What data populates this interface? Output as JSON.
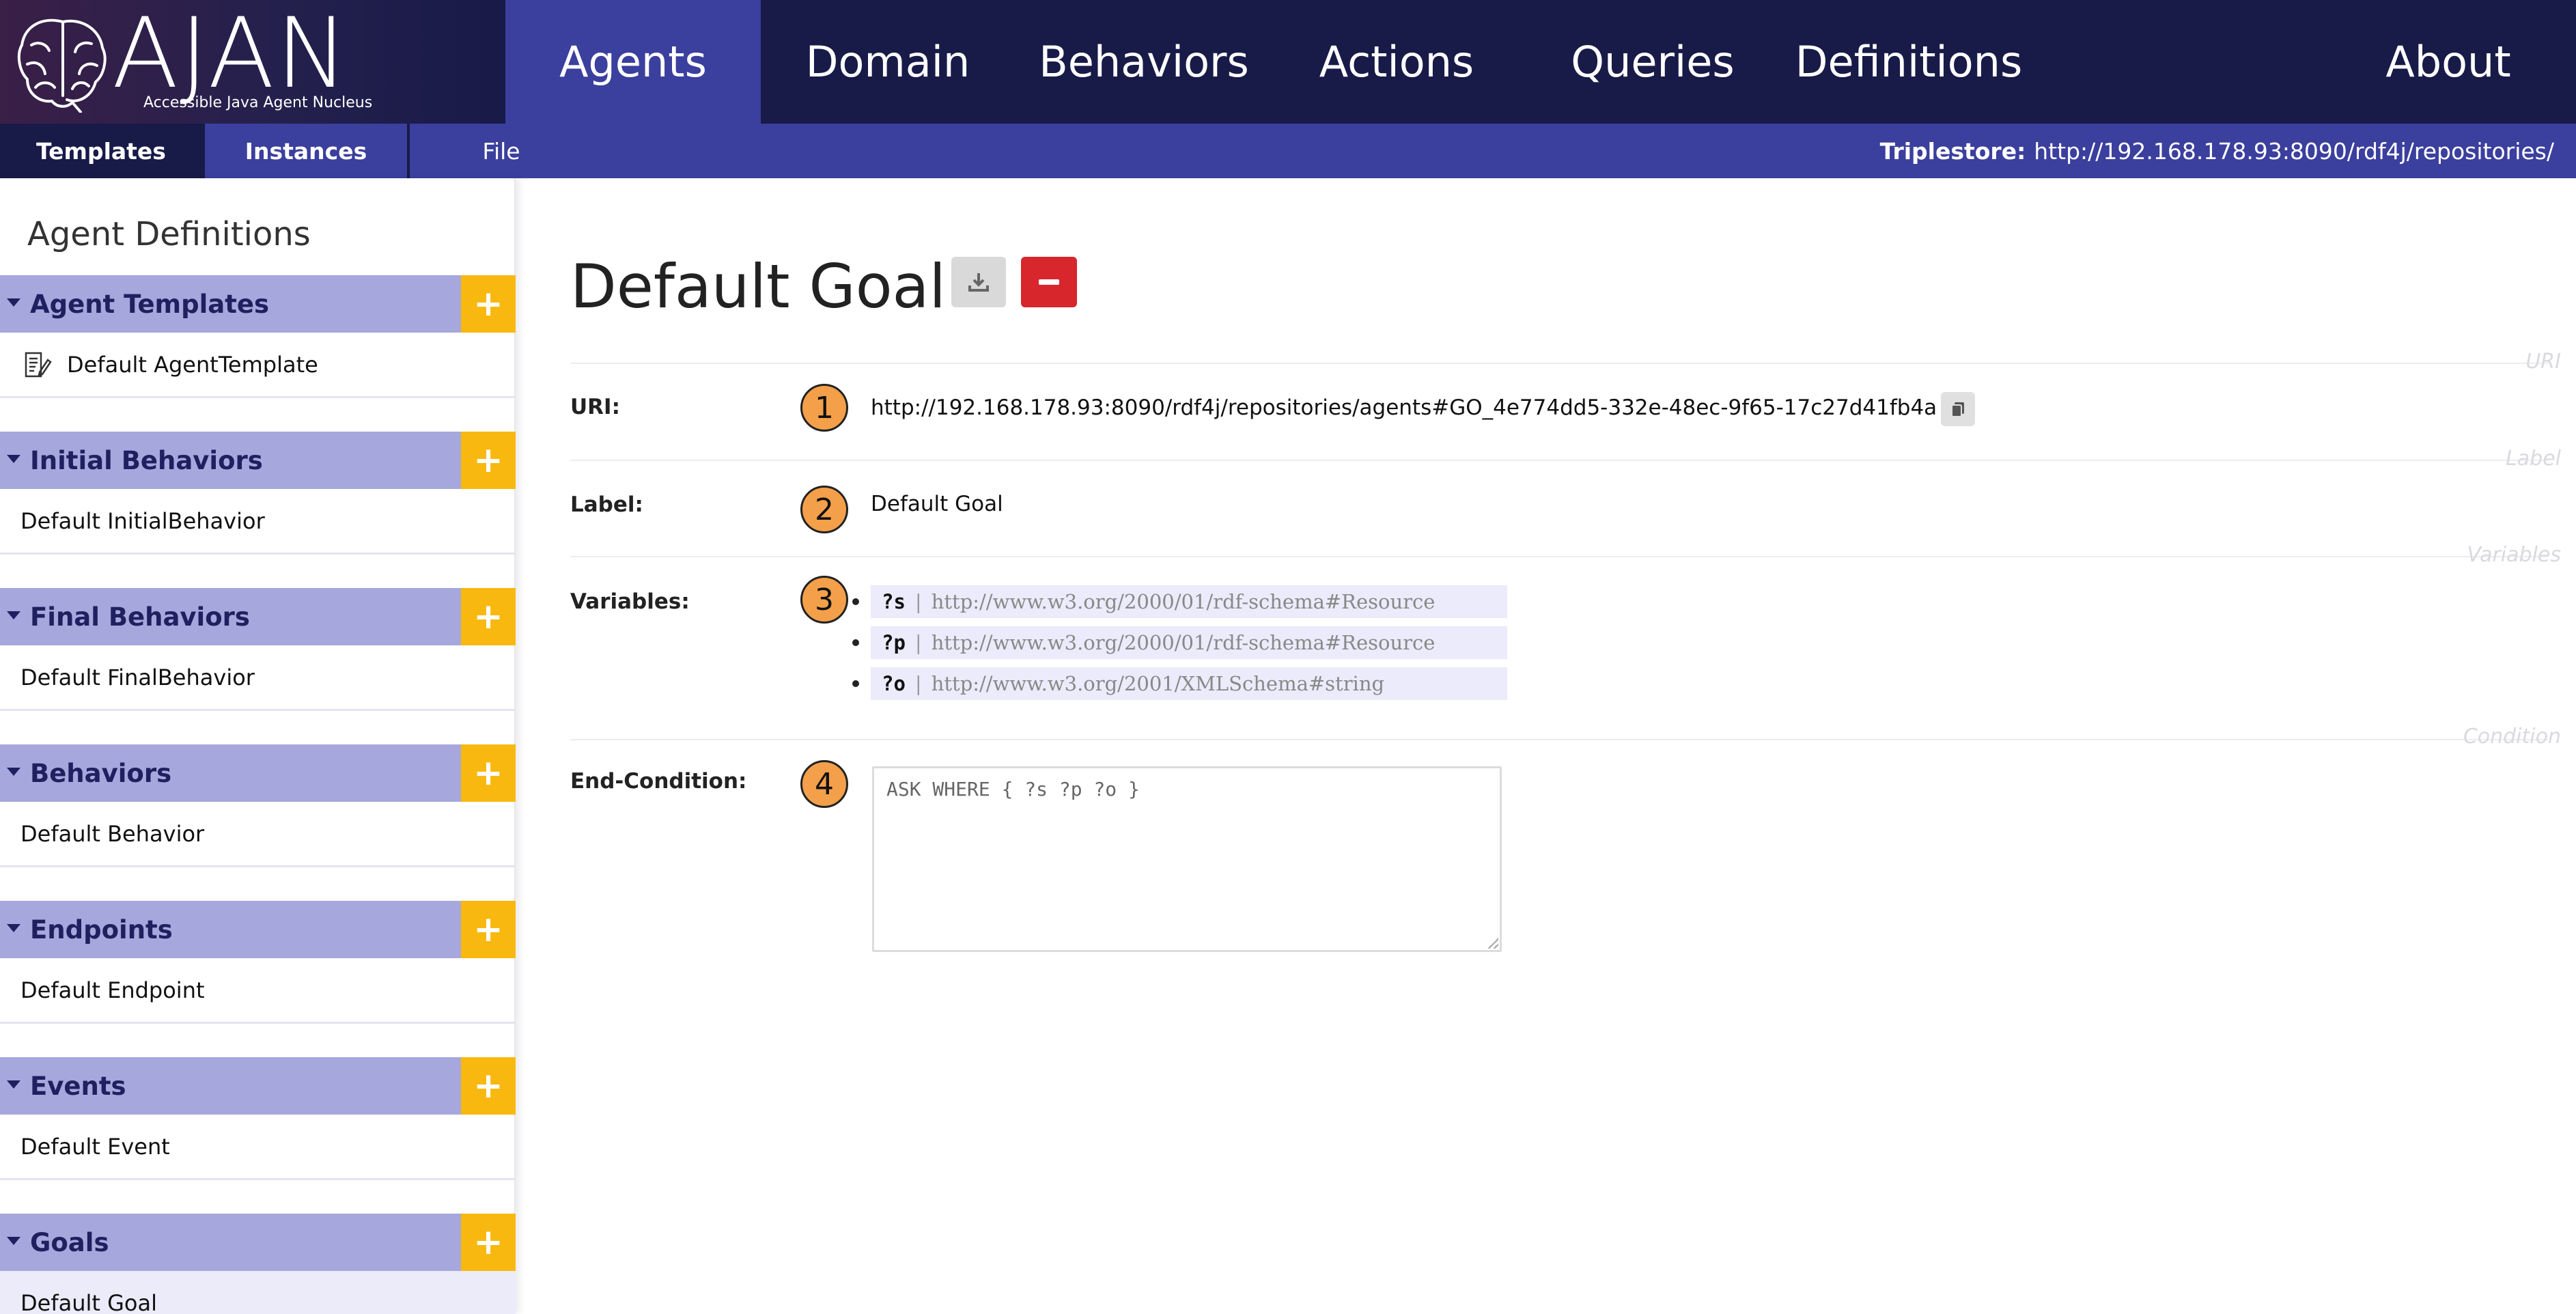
{
  "logo": {
    "title": "AJAN",
    "subtitle": "Accessible Java Agent Nucleus"
  },
  "nav": {
    "items": [
      {
        "label": "Agents",
        "active": true
      },
      {
        "label": "Domain"
      },
      {
        "label": "Behaviors"
      },
      {
        "label": "Actions"
      },
      {
        "label": "Queries"
      },
      {
        "label": "Definitions"
      },
      {
        "label": "About"
      }
    ]
  },
  "subnav": {
    "tabs": [
      {
        "label": "Templates",
        "active": true
      },
      {
        "label": "Instances"
      },
      {
        "label": "File"
      }
    ],
    "triplestore_label": "Triplestore:",
    "triplestore_url": "http://192.168.178.93:8090/rdf4j/repositories/"
  },
  "sidebar": {
    "title": "Agent Definitions",
    "add_symbol": "+",
    "sections": [
      {
        "title": "Agent Templates",
        "item": "Default AgentTemplate",
        "item_icon": "document-edit-icon"
      },
      {
        "title": "Initial Behaviors",
        "item": "Default InitialBehavior"
      },
      {
        "title": "Final Behaviors",
        "item": "Default FinalBehavior"
      },
      {
        "title": "Behaviors",
        "item": "Default Behavior"
      },
      {
        "title": "Endpoints",
        "item": "Default Endpoint"
      },
      {
        "title": "Events",
        "item": "Default Event"
      },
      {
        "title": "Goals",
        "item": "Default Goal",
        "selected": true
      }
    ]
  },
  "main": {
    "title": "Default Goal",
    "ghost_labels": {
      "uri": "URI",
      "label": "Label",
      "variables": "Variables",
      "condition": "Condition"
    },
    "fields": {
      "uri": {
        "label": "URI:",
        "badge": "1",
        "value": "http://192.168.178.93:8090/rdf4j/repositories/agents#GO_4e774dd5-332e-48ec-9f65-17c27d41fb4a"
      },
      "label": {
        "label": "Label:",
        "badge": "2",
        "value": "Default Goal"
      },
      "variables": {
        "label": "Variables:",
        "badge": "3",
        "items": [
          {
            "name": "?s",
            "separator": "|",
            "type": "http://www.w3.org/2000/01/rdf-schema#Resource"
          },
          {
            "name": "?p",
            "separator": "|",
            "type": "http://www.w3.org/2000/01/rdf-schema#Resource"
          },
          {
            "name": "?o",
            "separator": "|",
            "type": "http://www.w3.org/2001/XMLSchema#string"
          }
        ]
      },
      "end_condition": {
        "label": "End-Condition:",
        "badge": "4",
        "value": "ASK WHERE { ?s ?p ?o }"
      }
    }
  },
  "colors": {
    "nav_bg": "#181a48",
    "nav_active": "#3b3f9d",
    "section_header": "#a6a7dc",
    "add_button": "#f9b80f",
    "delete_button": "#d7262c",
    "badge": "#f4a04a"
  }
}
